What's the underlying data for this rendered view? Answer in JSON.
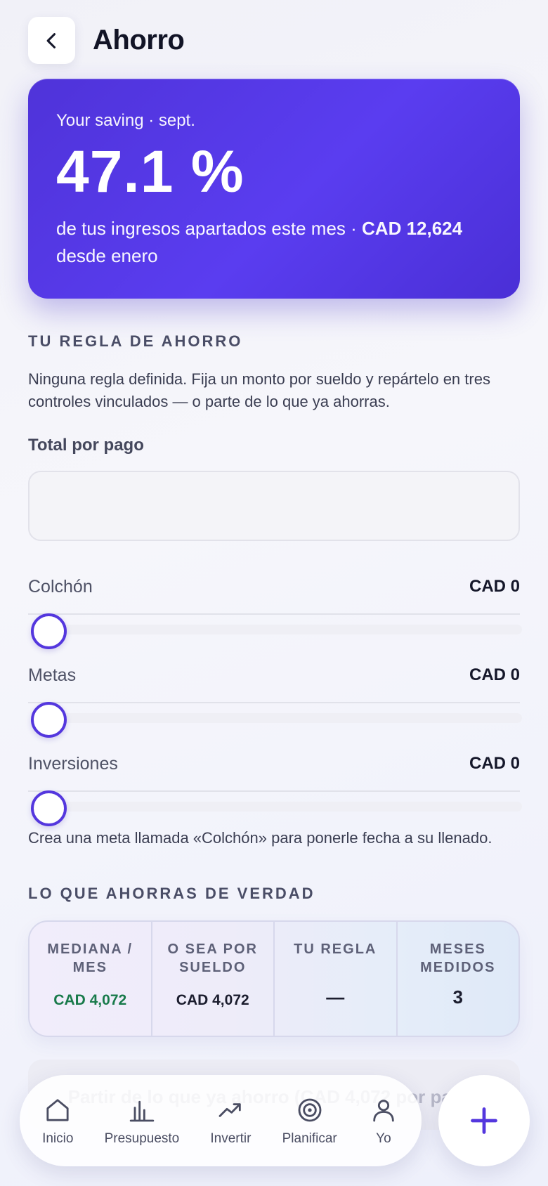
{
  "header": {
    "title": "Ahorro"
  },
  "hero": {
    "eyebrow": "Your saving · sept.",
    "value": "47.1 %",
    "desc_prefix": "de tus ingresos apartados este mes · ",
    "desc_amount": "CAD 12,624",
    "desc_suffix": " desde enero"
  },
  "rule": {
    "title": "TU REGLA DE AHORRO",
    "description": "Ninguna regla definida. Fija un monto por sueldo y repártelo en tres controles vinculados — o parte de lo que ya ahorras.",
    "total_label": "Total por pago",
    "total_value": "",
    "sliders": [
      {
        "label": "Colchón",
        "amount": "CAD 0",
        "level": 0
      },
      {
        "label": "Metas",
        "amount": "CAD 0",
        "level": 0
      },
      {
        "label": "Inversiones",
        "amount": "CAD 0",
        "level": 0
      }
    ],
    "note": "Crea una meta llamada «Colchón» para ponerle fecha a su llenado."
  },
  "actual": {
    "title": "LO QUE AHORRAS DE VERDAD",
    "stats": [
      {
        "label": "MEDIANA / MES",
        "value": "CAD 4,072"
      },
      {
        "label": "O SEA POR SUELDO",
        "value": "CAD 4,072"
      },
      {
        "label": "TU REGLA",
        "value": "—"
      },
      {
        "label": "MESES MEDIDOS",
        "value": "3"
      }
    ],
    "action_label": "Partir de lo que ya ahorro (CAD 4,072 por pago)"
  },
  "nav": {
    "items": [
      {
        "label": "Inicio",
        "icon": "home-icon"
      },
      {
        "label": "Presupuesto",
        "icon": "bar-chart-icon"
      },
      {
        "label": "Invertir",
        "icon": "trend-up-icon"
      },
      {
        "label": "Planificar",
        "icon": "target-icon"
      },
      {
        "label": "Yo",
        "icon": "user-icon"
      }
    ],
    "fab_icon": "plus-icon"
  },
  "colors": {
    "accent": "#5437de",
    "positive": "#187a4a"
  }
}
